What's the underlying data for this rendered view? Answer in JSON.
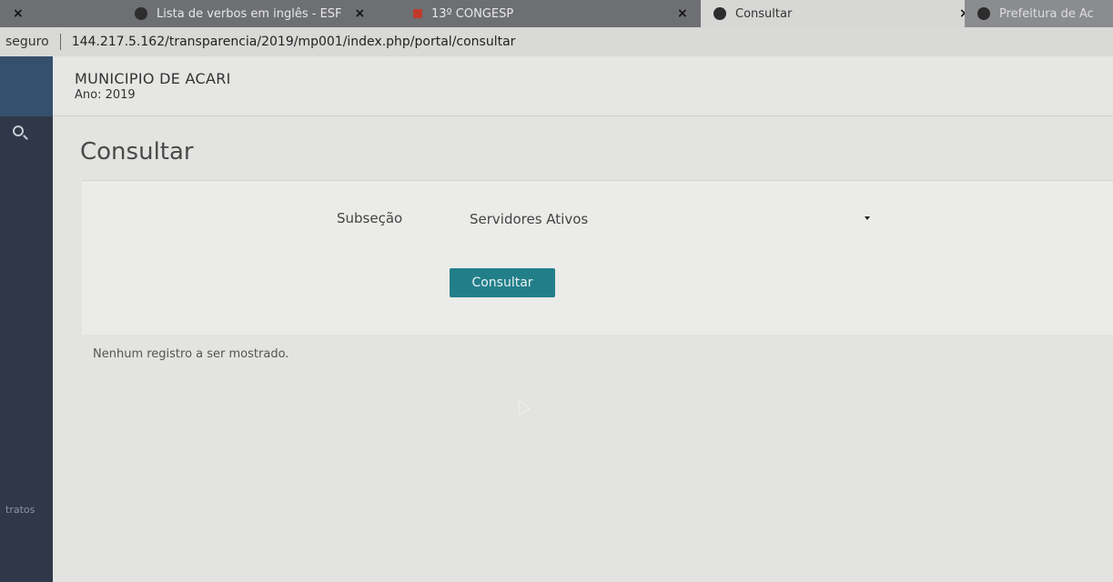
{
  "browser": {
    "tabs": [
      {
        "label": "",
        "active": false
      },
      {
        "label": "Lista de verbos em inglês - ESF",
        "active": false
      },
      {
        "label": "13º CONGESP",
        "active": false
      },
      {
        "label": "Consultar",
        "active": true
      },
      {
        "label": "Prefeitura de Ac",
        "active": false
      }
    ],
    "security_label": "seguro",
    "url": "144.217.5.162/transparencia/2019/mp001/index.php/portal/consultar"
  },
  "sidebar": {
    "item_label": "tratos"
  },
  "header": {
    "municipality": "MUNICIPIO DE ACARI",
    "year": "Ano: 2019"
  },
  "main": {
    "title": "Consultar",
    "form": {
      "subsecao_label": "Subseção",
      "subsecao_value": "Servidores Ativos",
      "submit_label": "Consultar"
    },
    "empty_message": "Nenhum registro a ser mostrado."
  },
  "colors": {
    "button": "#227f8a",
    "sidebar": "#2f3748",
    "background": "#e3e3e1"
  }
}
